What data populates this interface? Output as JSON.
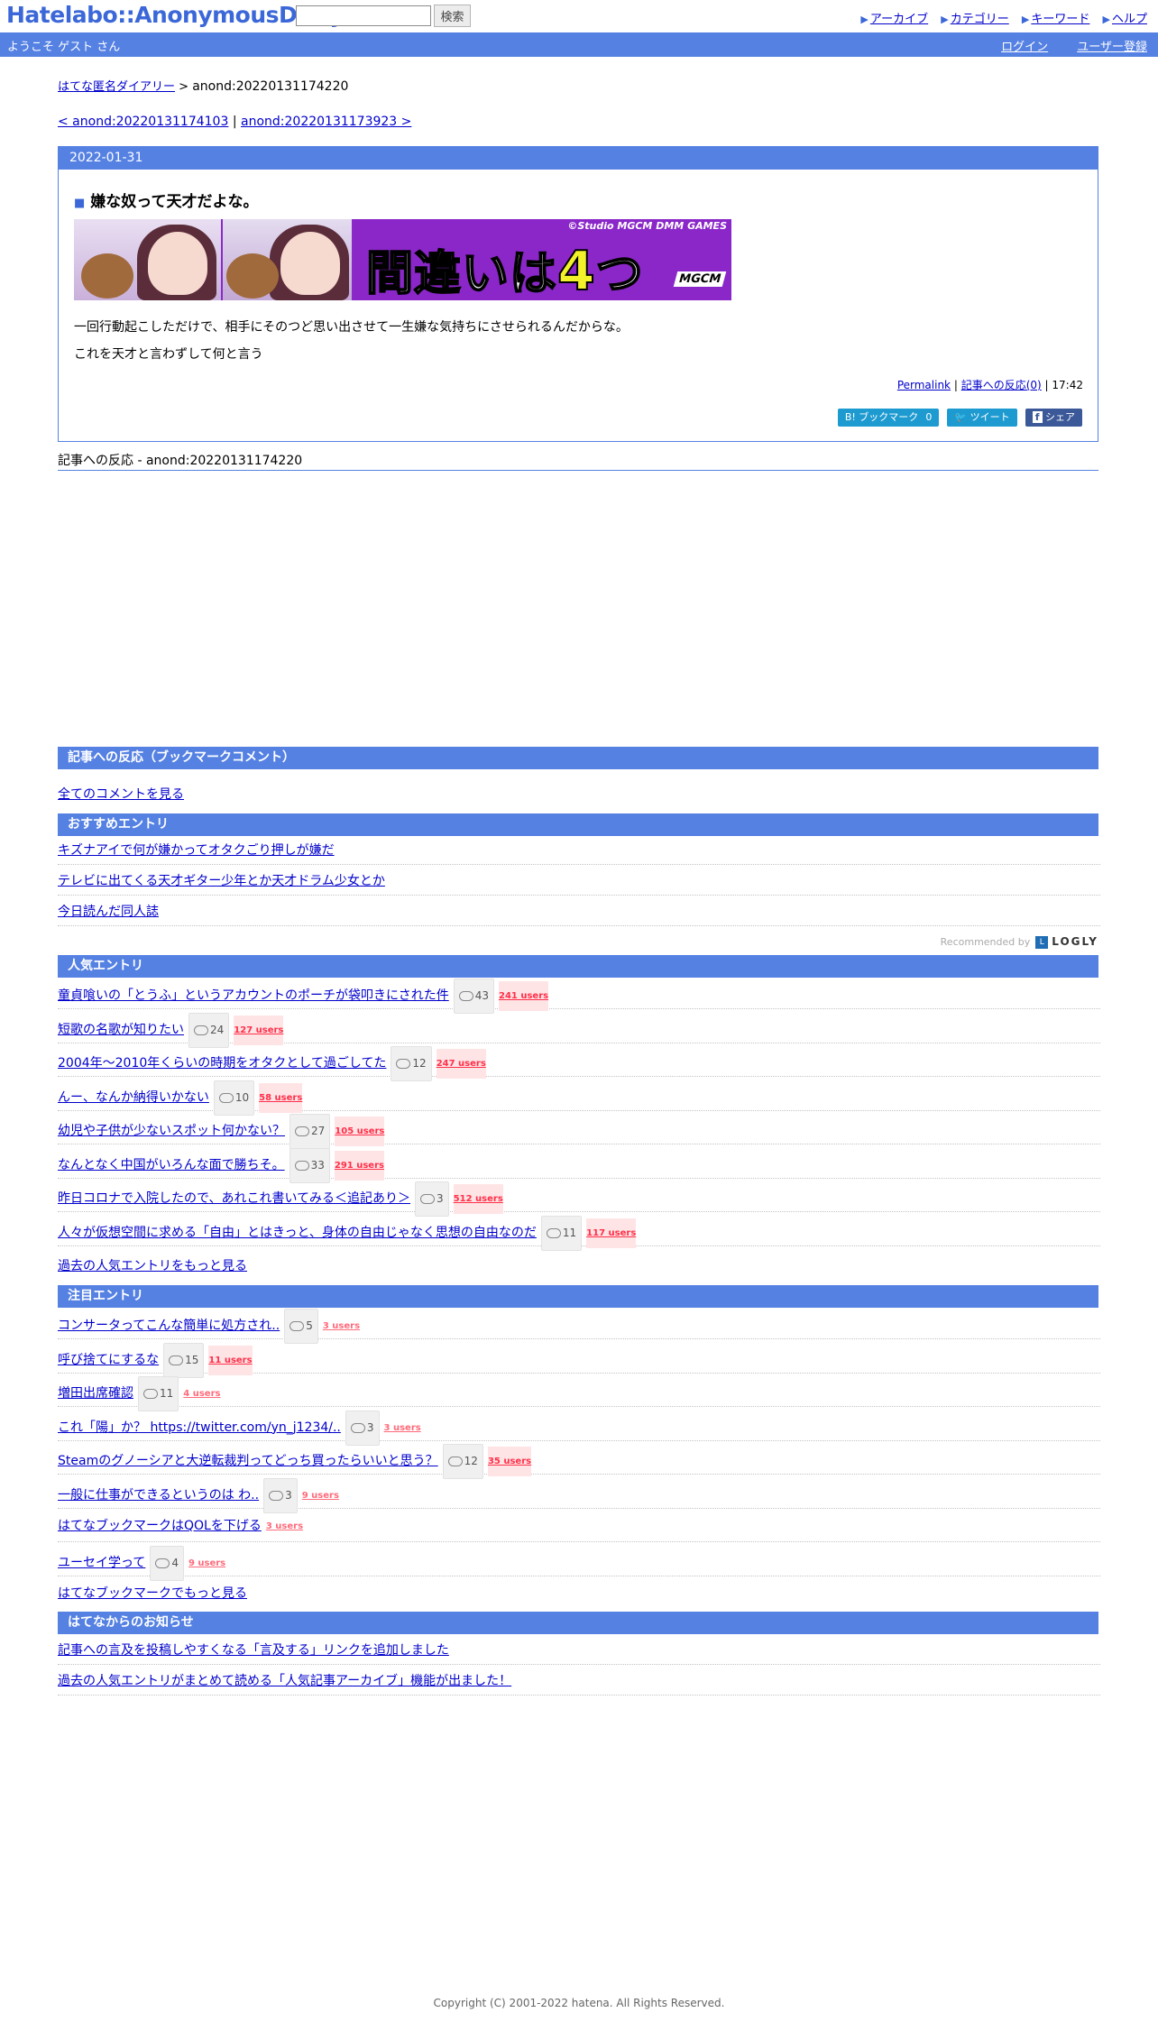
{
  "header": {
    "logo": "Hatelabo::AnonymousDiary",
    "search_button": "検索",
    "nav": [
      "アーカイブ",
      "カテゴリー",
      "キーワード",
      "ヘルプ"
    ]
  },
  "welcome": {
    "text": "ようこそ ゲスト さん",
    "login": "ログイン",
    "register": "ユーザー登録"
  },
  "breadcrumb": {
    "home": "はてな匿名ダイアリー",
    "sep": ">",
    "current": "anond:20220131174220"
  },
  "pager": {
    "prev": "< anond:20220131174103",
    "sep": "|",
    "next": "anond:20220131173923 >"
  },
  "entry": {
    "date": "2022-01-31",
    "marker": "■",
    "title": "嫌な奴って天才だよな。",
    "banner": {
      "studio": "©Studio MGCM DMM GAMES",
      "title_prefix": "間違いは",
      "title_num": "4",
      "title_suffix": "つ"
    },
    "body": [
      "一回行動起こしただけで、相手にそのつど思い出させて一生嫌な気持ちにさせられるんだからな。",
      "これを天才と言わずして何と言う"
    ],
    "permalink": "Permalink",
    "sep": "|",
    "reactions_link": "記事への反応(0)",
    "time": "| 17:42",
    "share": {
      "hatena": "B! ブックマーク",
      "hatena_count": "0",
      "tweet": "ツイート",
      "facebook": "シェア"
    }
  },
  "refs": {
    "label": "記事への反応 - ",
    "target": "anond:20220131174220"
  },
  "bookmark_comments": {
    "title": "記事への反応（ブックマークコメント）",
    "see_all": "全てのコメントを見る"
  },
  "recommended": {
    "title": "おすすめエントリ",
    "items": [
      "キズナアイで何が嫌かってオタクごり押しが嫌だ",
      "テレビに出てくる天才ギター少年とか天才ドラム少女とか",
      "今日読んだ同人誌"
    ],
    "credit": "Recommended by",
    "credit_mark": "L",
    "credit_brand": "LOGLY"
  },
  "popular": {
    "title": "人気エントリ",
    "items": [
      {
        "title": "童貞喰いの「とうふ」というアカウントのポーチが袋叩きにされた件",
        "comments": "43",
        "users": "241 users"
      },
      {
        "title": "短歌の名歌が知りたい",
        "comments": "24",
        "users": "127 users"
      },
      {
        "title": "2004年～2010年くらいの時期をオタクとして過ごしてた",
        "comments": "12",
        "users": "247 users"
      },
      {
        "title": "んー、なんか納得いかない",
        "comments": "10",
        "users": "58 users"
      },
      {
        "title": "幼児や子供が少ないスポット何かない？",
        "comments": "27",
        "users": "105 users"
      },
      {
        "title": "なんとなく中国がいろんな面で勝ちそ。",
        "comments": "33",
        "users": "291 users"
      },
      {
        "title": "昨日コロナで入院したので、あれこれ書いてみる＜追記あり＞",
        "comments": "3",
        "users": "512 users"
      },
      {
        "title": "人々が仮想空間に求める「自由」とはきっと、身体の自由じゃなく思想の自由なのだ",
        "comments": "11",
        "users": "117 users"
      }
    ],
    "more": "過去の人気エントリをもっと見る"
  },
  "notable": {
    "title": "注目エントリ",
    "items": [
      {
        "title": "コンサータってこんな簡単に処方され..",
        "comments": "5",
        "users": "3 users",
        "hot": false
      },
      {
        "title": "呼び捨てにするな",
        "comments": "15",
        "users": "11 users",
        "hot": true
      },
      {
        "title": "増田出席確認",
        "comments": "11",
        "users": "4 users",
        "hot": false
      },
      {
        "title": "これ「陽」か？ https://twitter.com/yn_j1234/..",
        "comments": "3",
        "users": "3 users",
        "hot": false
      },
      {
        "title": "Steamのグノーシアと大逆転裁判ってどっち買ったらいいと思う？",
        "comments": "12",
        "users": "35 users",
        "hot": true
      },
      {
        "title": "一般に仕事ができるというのは わ..",
        "comments": "3",
        "users": "9 users",
        "hot": false
      },
      {
        "title": "はてなブックマークはQOLを下げる",
        "comments": "",
        "users": "3 users",
        "hot": false
      },
      {
        "title": "ユーセイ学って",
        "comments": "4",
        "users": "9 users",
        "hot": false
      }
    ],
    "more": "はてなブックマークでもっと見る"
  },
  "news": {
    "title": "はてなからのお知らせ",
    "items": [
      "記事への言及を投稿しやすくなる「言及する」リンクを追加しました",
      "過去の人気エントリがまとめて読める「人気記事アーカイブ」機能が出ました！"
    ]
  },
  "footer": {
    "copyright": "Copyright (C) 2001-2022 hatena. All Rights Reserved."
  }
}
